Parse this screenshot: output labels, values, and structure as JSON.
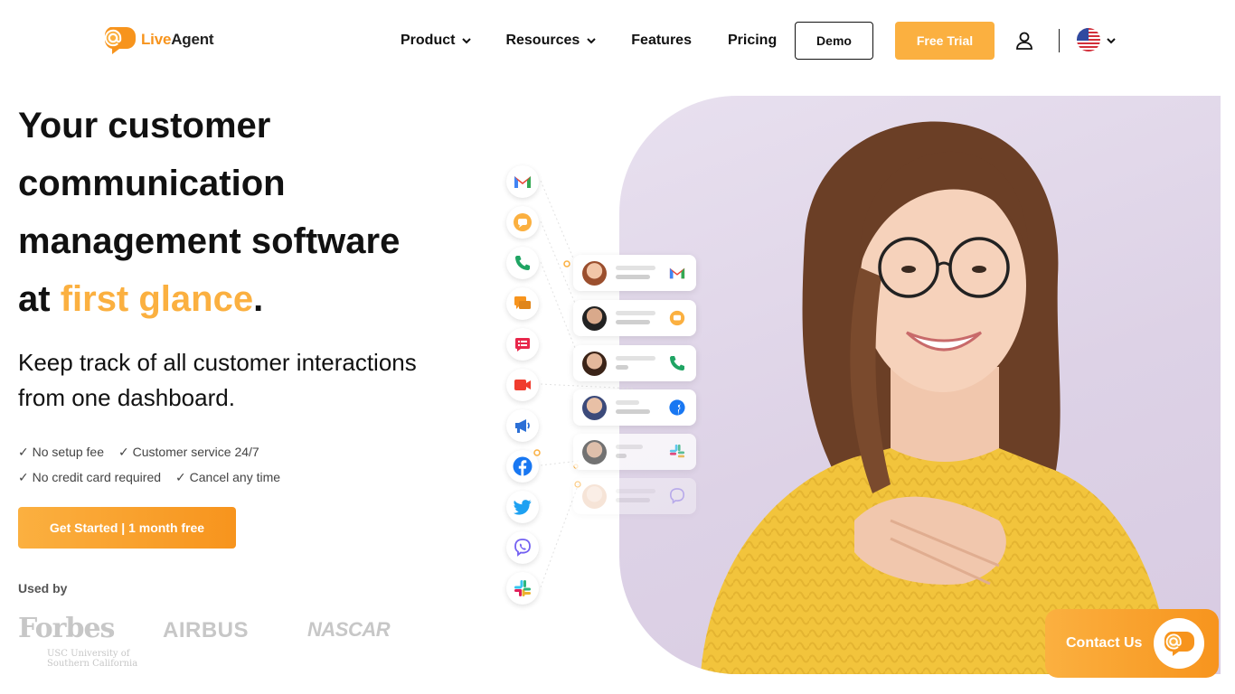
{
  "brand": {
    "logo_live": "Live",
    "logo_agent": "Agent"
  },
  "nav": {
    "product": "Product",
    "resources": "Resources",
    "features": "Features",
    "pricing": "Pricing",
    "demo": "Demo",
    "free_trial": "Free Trial"
  },
  "hero": {
    "headline_line1": "Your customer",
    "headline_line2": "communication",
    "headline_line3": "management software",
    "headline_at": "at ",
    "headline_accent": "first glance",
    "headline_period": ".",
    "subline": "Keep track of all customer interactions from one dashboard.",
    "checks": [
      "✓ No setup fee",
      "✓ Customer service 24/7",
      "✓ No credit card required",
      "✓ Cancel any time"
    ],
    "cta": "Get Started | 1 month free",
    "used_by": "Used by",
    "brands": [
      "Forbes",
      "AIRBUS",
      "NASCAR",
      "USC University of Southern California"
    ]
  },
  "channels": [
    "gmail-icon",
    "chat-icon",
    "phone-icon",
    "messages-icon",
    "form-icon",
    "video-icon",
    "megaphone-icon",
    "facebook-icon",
    "twitter-icon",
    "viber-icon",
    "slack-icon"
  ],
  "contact": {
    "label": "Contact Us"
  },
  "colors": {
    "accent": "#fbb040",
    "accent_dark": "#f7941d"
  }
}
